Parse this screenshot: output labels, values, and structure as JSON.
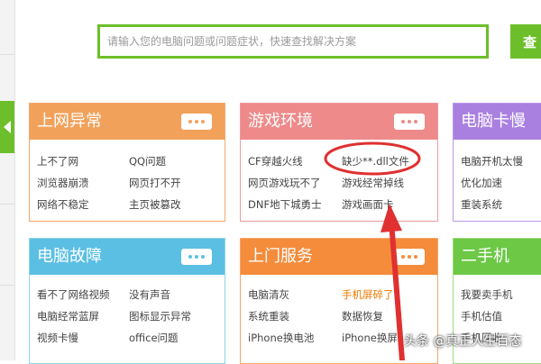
{
  "search": {
    "placeholder": "请输入您的电脑问题或问题症状，快速查找解决方案",
    "button_label": "查"
  },
  "cards": {
    "internet": {
      "title": "上网异常",
      "links": [
        "上不了网",
        "QQ问题",
        "浏览器崩溃",
        "网页打不开",
        "网络不稳定",
        "主页被篡改"
      ]
    },
    "game": {
      "title": "游戏环境",
      "links": [
        "CF穿越火线",
        "缺少**.dll文件",
        "网页游戏玩不了",
        "游戏经常掉线",
        "DNF地下城勇士",
        "游戏画面卡"
      ]
    },
    "lag": {
      "title": "电脑卡慢",
      "links": [
        "电脑开机太慢",
        "优化加速",
        "重装系统"
      ]
    },
    "fault": {
      "title": "电脑故障",
      "links": [
        "看不了网络视频",
        "没有声音",
        "电脑经常蓝屏",
        "图标显示异常",
        "视频卡慢",
        "office问题"
      ]
    },
    "service": {
      "title": "上门服务",
      "links": [
        "电脑清灰",
        "手机屏碎了",
        "系统重装",
        "数据恢复",
        "iPhone换电池",
        "iPhone换屏"
      ]
    },
    "second": {
      "title": "二手机",
      "links": [
        "我要卖手机",
        "手机估值",
        "手机回收"
      ]
    }
  },
  "colors": {
    "accent_green": "#6cbf2a",
    "annotation_red": "#e03030"
  },
  "watermark": "头条 @真正人生百态"
}
